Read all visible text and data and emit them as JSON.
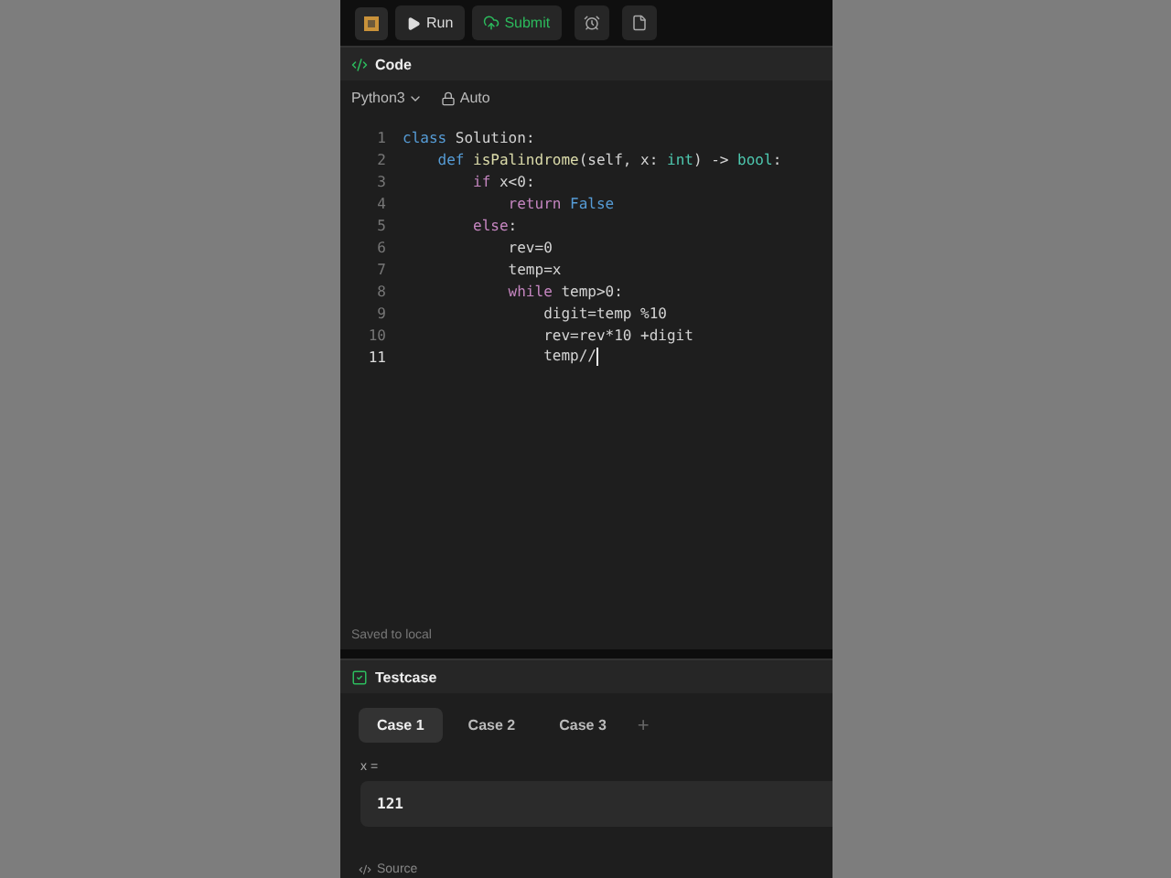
{
  "toolbar": {
    "run": "Run",
    "submit": "Submit"
  },
  "code_panel": {
    "title": "Code",
    "language": "Python3",
    "mode": "Auto",
    "lines": [
      {
        "number": "1",
        "current": false,
        "tokens": [
          {
            "text": "class",
            "kind": "keyword"
          },
          {
            "text": " Solution:",
            "kind": "plain"
          }
        ]
      },
      {
        "number": "2",
        "current": false,
        "tokens": [
          {
            "text": "    def ",
            "kind": "keyword"
          },
          {
            "text": "isPalindrome",
            "kind": "function"
          },
          {
            "text": "(self, x: ",
            "kind": "plain"
          },
          {
            "text": "int",
            "kind": "type"
          },
          {
            "text": ") -> ",
            "kind": "plain"
          },
          {
            "text": "bool",
            "kind": "type"
          },
          {
            "text": ":",
            "kind": "plain"
          }
        ]
      },
      {
        "number": "3",
        "current": false,
        "tokens": [
          {
            "text": "        if",
            "kind": "control"
          },
          {
            "text": " x<0:",
            "kind": "plain"
          }
        ]
      },
      {
        "number": "4",
        "current": false,
        "tokens": [
          {
            "text": "            return ",
            "kind": "control"
          },
          {
            "text": "False",
            "kind": "keyword"
          }
        ]
      },
      {
        "number": "5",
        "current": false,
        "tokens": [
          {
            "text": "        else",
            "kind": "control"
          },
          {
            "text": ":",
            "kind": "plain"
          }
        ]
      },
      {
        "number": "6",
        "current": false,
        "tokens": [
          {
            "text": "            rev=0",
            "kind": "plain"
          }
        ]
      },
      {
        "number": "7",
        "current": false,
        "tokens": [
          {
            "text": "            temp=x",
            "kind": "plain"
          }
        ]
      },
      {
        "number": "8",
        "current": false,
        "tokens": [
          {
            "text": "            while",
            "kind": "control"
          },
          {
            "text": " temp>0:",
            "kind": "plain"
          }
        ]
      },
      {
        "number": "9",
        "current": false,
        "tokens": [
          {
            "text": "                digit=temp %10",
            "kind": "plain"
          }
        ]
      },
      {
        "number": "10",
        "current": false,
        "tokens": [
          {
            "text": "                rev=rev*10 +digit",
            "kind": "plain"
          }
        ]
      },
      {
        "number": "11",
        "current": true,
        "tokens": [
          {
            "text": "                temp//",
            "kind": "plain"
          }
        ]
      }
    ],
    "status": "Saved to local"
  },
  "testcase_panel": {
    "title": "Testcase",
    "cases": [
      {
        "label": "Case 1",
        "selected": true
      },
      {
        "label": "Case 2",
        "selected": false
      },
      {
        "label": "Case 3",
        "selected": false
      }
    ],
    "add": "+",
    "variable": "x =",
    "value": "121",
    "source": "Source"
  }
}
